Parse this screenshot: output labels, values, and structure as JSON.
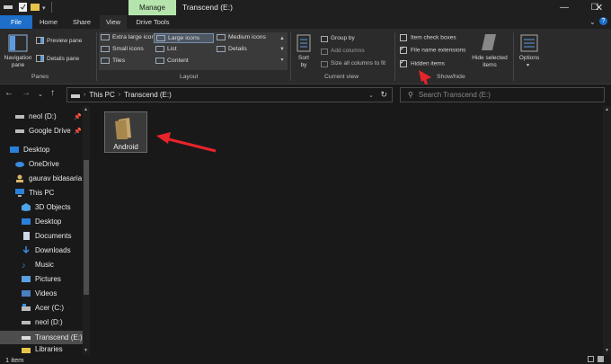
{
  "window": {
    "title": "Transcend (E:)",
    "manage_tab": "Manage",
    "minimize": "—",
    "maximize": "☐",
    "close": "✕"
  },
  "tabs": [
    "File",
    "Home",
    "Share",
    "View",
    "Drive Tools"
  ],
  "ribbon": {
    "panes": {
      "navigation_pane": "Navigation",
      "navigation_pane_2": "pane",
      "preview_pane": "Preview pane",
      "details_pane": "Details pane",
      "group_label": "Panes"
    },
    "layout": {
      "extra_large_icons": "Extra large icons",
      "large_icons": "Large icons",
      "medium_icons": "Medium icons",
      "small_icons": "Small icons",
      "list": "List",
      "details": "Details",
      "tiles": "Tiles",
      "content": "Content",
      "group_label": "Layout"
    },
    "current_view": {
      "sort_by": "Sort",
      "sort_by_2": "by",
      "group_by": "Group by",
      "add_columns": "Add columns",
      "size_all_columns": "Size all columns to fit",
      "group_label": "Current view"
    },
    "show_hide": {
      "item_check_boxes": "Item check boxes",
      "file_name_extensions": "File name extensions",
      "hidden_items": "Hidden items",
      "hide_selected": "Hide selected",
      "hide_selected_2": "items",
      "group_label": "Show/hide"
    },
    "options": "Options"
  },
  "address": {
    "crumb1": "This PC",
    "crumb2": "Transcend (E:)",
    "search_placeholder": "Search Transcend (E:)"
  },
  "sidebar": {
    "items": [
      {
        "label": "neol (D:)"
      },
      {
        "label": "Google Drive"
      },
      {
        "label": "Desktop"
      },
      {
        "label": "OneDrive"
      },
      {
        "label": "gaurav bidasaria"
      },
      {
        "label": "This PC"
      },
      {
        "label": "3D Objects"
      },
      {
        "label": "Desktop"
      },
      {
        "label": "Documents"
      },
      {
        "label": "Downloads"
      },
      {
        "label": "Music"
      },
      {
        "label": "Pictures"
      },
      {
        "label": "Videos"
      },
      {
        "label": "Acer (C:)"
      },
      {
        "label": "neol (D:)"
      },
      {
        "label": "Transcend (E:)"
      },
      {
        "label": "Libraries"
      }
    ]
  },
  "content": {
    "folder": "Android"
  },
  "status": {
    "count": "1 item"
  },
  "colors": {
    "accent": "#1d6fc9",
    "arrow": "#e8232b",
    "manage": "#b5e5ad"
  }
}
